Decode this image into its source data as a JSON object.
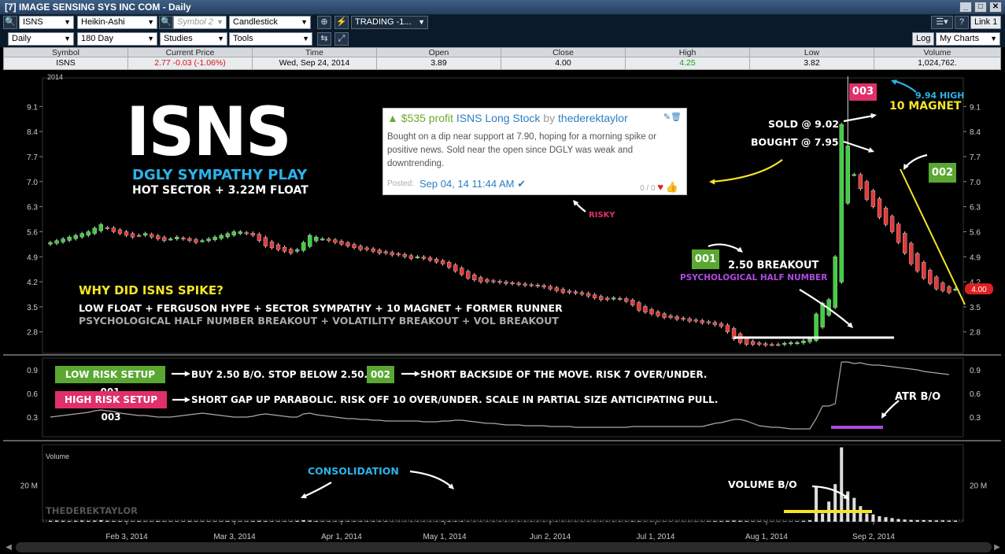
{
  "window": {
    "title": "[7] IMAGE SENSING SYS INC COM - Daily"
  },
  "toolbar1": {
    "symbol": "ISNS",
    "chart_style": "Heikin-Ashi",
    "symbol2_placeholder": "Symbol 2",
    "chart_type": "Candlestick",
    "trading": "TRADING -1...",
    "link": "Link 1"
  },
  "toolbar2": {
    "interval": "Daily",
    "range": "180 Day",
    "studies": "Studies",
    "tools": "Tools",
    "log": "Log",
    "my_charts": "My Charts"
  },
  "quote": {
    "headers": [
      "Symbol",
      "Current Price",
      "Time",
      "Open",
      "Close",
      "High",
      "Low",
      "Volume"
    ],
    "symbol": "ISNS",
    "current_price": "2.77",
    "change": "-0.03 (-1.06%)",
    "time": "Wed, Sep 24, 2014",
    "open": "3.89",
    "close": "4.00",
    "high": "4.25",
    "low": "3.82",
    "volume": "1,024,762."
  },
  "colors": {
    "up": "#3fcf3f",
    "down": "#e23a3a",
    "yellow": "#f4e525",
    "cyan": "#2bb3ea",
    "green_badge": "#5aa832",
    "pink_badge": "#e0306b",
    "purple": "#b04ae0"
  },
  "overlay": {
    "ticker": "ISNS",
    "subtitle1": "DGLY SYMPATHY PLAY",
    "subtitle2": "HOT SECTOR + 3.22M FLOAT",
    "why_title": "WHY DID ISNS SPIKE?",
    "reasons1": "LOW FLOAT + FERGUSON HYPE + SECTOR SYMPATHY + 10 MAGNET + FORMER RUNNER",
    "reasons2": "PSYCHOLOGICAL HALF NUMBER BREAKOUT + VOLATILITY BREAKOUT + VOL BREAKOUT",
    "risky": "RISKY",
    "badge001": "001",
    "badge002": "002",
    "badge003": "003",
    "breakout": "2.50 BREAKOUT",
    "half_number": "PSYCHOLOGICAL HALF NUMBER",
    "sold": "SOLD @ 9.02",
    "bought": "BOUGHT @ 7.95",
    "high_label": "9.94 HIGH",
    "magnet": "10 MAGNET",
    "low_risk": "LOW RISK SETUP 001",
    "low_risk_text": "BUY 2.50 B/O.  STOP BELOW 2.50.",
    "short_text": "SHORT BACKSIDE OF THE MOVE.  RISK 7 OVER/UNDER.",
    "high_risk": "HIGH RISK SETUP 003",
    "high_risk_text": "SHORT GAP UP PARABOLIC.  RISK OFF 10 OVER/UNDER.  SCALE IN PARTIAL SIZE ANTICIPATING PULL.",
    "atr": "ATR B/O",
    "consolidation": "CONSOLIDATION",
    "volume_bo": "VOLUME B/O",
    "watermark": "THEDEREKTAYLOR"
  },
  "post": {
    "profit": "$535 profit",
    "title": "ISNS Long Stock",
    "by": "by",
    "author": "thederektaylor",
    "body": "Bought on a dip near support at 7.90, hoping for a morning spike or positive news. Sold near the open since DGLY was weak and downtrending.",
    "posted": "Posted:",
    "date": "Sep 04, 14 11:44 AM",
    "votes": "0 / 0"
  },
  "chart_data": {
    "type": "candlestick",
    "year_label": "2014",
    "x_labels": [
      "Feb 3, 2014",
      "Mar 3, 2014",
      "Apr 1, 2014",
      "May 1, 2014",
      "Jun 2, 2014",
      "Jul 1, 2014",
      "Aug 1, 2014",
      "Sep 2, 2014"
    ],
    "price_ticks": [
      "9.1",
      "8.4",
      "7.7",
      "7.0",
      "6.3",
      "5.6",
      "4.9",
      "4.2",
      "3.5",
      "2.8"
    ],
    "price_range": [
      2.2,
      9.9
    ],
    "last_price_label": "4.00",
    "atr_ticks": [
      "0.9",
      "0.6",
      "0.3"
    ],
    "atr_range": [
      0.05,
      1.05
    ],
    "volume_label": "Volume",
    "volume_tick": "20 M",
    "volume_range_m": [
      0,
      42
    ],
    "closes": [
      5.3,
      5.35,
      5.4,
      5.45,
      5.5,
      5.55,
      5.6,
      5.7,
      5.8,
      5.7,
      5.6,
      5.55,
      5.5,
      5.45,
      5.5,
      5.55,
      5.45,
      5.4,
      5.35,
      5.4,
      5.45,
      5.4,
      5.35,
      5.3,
      5.35,
      5.4,
      5.45,
      5.5,
      5.55,
      5.6,
      5.6,
      5.55,
      5.5,
      5.35,
      5.2,
      5.15,
      5.1,
      5.05,
      5.0,
      5.1,
      5.3,
      5.5,
      5.45,
      5.4,
      5.35,
      5.3,
      5.25,
      5.2,
      5.15,
      5.1,
      5.1,
      5.05,
      5.0,
      5.0,
      4.95,
      4.95,
      4.9,
      4.85,
      4.9,
      4.85,
      4.8,
      4.75,
      4.7,
      4.6,
      4.5,
      4.4,
      4.3,
      4.25,
      4.2,
      4.2,
      4.2,
      4.18,
      4.15,
      4.15,
      4.12,
      4.1,
      4.1,
      4.08,
      4.05,
      4.0,
      3.95,
      3.9,
      3.9,
      3.88,
      3.85,
      3.8,
      3.75,
      3.7,
      3.7,
      3.75,
      3.72,
      3.65,
      3.55,
      3.4,
      3.35,
      3.3,
      3.25,
      3.2,
      3.2,
      3.15,
      3.15,
      3.1,
      3.1,
      3.05,
      3.05,
      3.0,
      2.95,
      2.8,
      2.6,
      2.5,
      2.45,
      2.45,
      2.45,
      2.43,
      2.45,
      2.45,
      2.48,
      2.5,
      2.5,
      2.55,
      2.6,
      3.3,
      3.6,
      3.7,
      4.9,
      8.6,
      8.0,
      7.2,
      6.8,
      6.5,
      6.3,
      6.0,
      5.8,
      5.6,
      5.3,
      5.0,
      4.7,
      4.5,
      4.3,
      4.15,
      4.0,
      3.95,
      3.9,
      4.0
    ],
    "atr": [
      0.3,
      0.31,
      0.32,
      0.33,
      0.34,
      0.35,
      0.36,
      0.38,
      0.39,
      0.38,
      0.37,
      0.35,
      0.34,
      0.33,
      0.32,
      0.32,
      0.31,
      0.3,
      0.3,
      0.3,
      0.31,
      0.32,
      0.33,
      0.34,
      0.35,
      0.34,
      0.33,
      0.32,
      0.31,
      0.3,
      0.3,
      0.3,
      0.31,
      0.33,
      0.34,
      0.33,
      0.32,
      0.31,
      0.3,
      0.3,
      0.34,
      0.35,
      0.33,
      0.32,
      0.31,
      0.3,
      0.29,
      0.28,
      0.28,
      0.27,
      0.27,
      0.26,
      0.26,
      0.25,
      0.25,
      0.25,
      0.25,
      0.25,
      0.25,
      0.24,
      0.24,
      0.24,
      0.25,
      0.25,
      0.26,
      0.26,
      0.25,
      0.24,
      0.23,
      0.22,
      0.22,
      0.21,
      0.2,
      0.2,
      0.2,
      0.19,
      0.19,
      0.19,
      0.19,
      0.18,
      0.18,
      0.18,
      0.18,
      0.17,
      0.17,
      0.17,
      0.17,
      0.17,
      0.17,
      0.17,
      0.17,
      0.17,
      0.18,
      0.18,
      0.18,
      0.18,
      0.18,
      0.18,
      0.18,
      0.18,
      0.18,
      0.18,
      0.18,
      0.18,
      0.2,
      0.22,
      0.23,
      0.25,
      0.27,
      0.27,
      0.25,
      0.22,
      0.19,
      0.18,
      0.17,
      0.17,
      0.16,
      0.15,
      0.15,
      0.15,
      0.15,
      0.28,
      0.44,
      0.44,
      0.47,
      1.0,
      1.0,
      0.98,
      0.99,
      0.97,
      0.96,
      0.96,
      0.95,
      0.94,
      0.93,
      0.92,
      0.91,
      0.9,
      0.88,
      0.87,
      0.86,
      0.85,
      0.84
    ],
    "volume_m": [
      0.5,
      0.6,
      0.5,
      0.4,
      0.5,
      0.6,
      0.5,
      0.6,
      0.8,
      0.5,
      0.4,
      0.4,
      0.3,
      0.3,
      0.4,
      0.3,
      0.3,
      0.4,
      0.3,
      0.3,
      0.3,
      0.3,
      0.4,
      0.3,
      0.3,
      0.3,
      0.3,
      0.3,
      0.4,
      0.3,
      0.3,
      0.3,
      0.4,
      0.5,
      0.4,
      0.3,
      0.3,
      0.3,
      0.3,
      0.5,
      0.8,
      0.6,
      0.4,
      0.3,
      0.3,
      0.3,
      0.3,
      0.3,
      0.3,
      0.3,
      0.3,
      0.3,
      0.3,
      0.3,
      0.2,
      0.2,
      0.2,
      0.2,
      0.2,
      0.2,
      0.2,
      0.2,
      0.3,
      0.3,
      0.3,
      0.3,
      0.2,
      0.2,
      0.2,
      0.2,
      0.2,
      0.2,
      0.2,
      0.2,
      0.2,
      0.2,
      0.2,
      0.2,
      0.2,
      0.2,
      0.2,
      0.2,
      0.2,
      0.2,
      0.2,
      0.2,
      0.2,
      0.2,
      0.2,
      0.2,
      0.2,
      0.2,
      0.3,
      0.3,
      0.2,
      0.2,
      0.2,
      0.2,
      0.2,
      0.2,
      0.2,
      0.2,
      0.2,
      0.2,
      0.3,
      0.4,
      0.4,
      0.5,
      0.6,
      0.5,
      0.4,
      0.3,
      0.3,
      0.2,
      0.2,
      0.2,
      0.2,
      0.2,
      0.3,
      0.5,
      0.8,
      19.5,
      4.5,
      11.0,
      20.5,
      40.5,
      16.5,
      13.0,
      8.5,
      4.5,
      4.0,
      3.0,
      2.5,
      2.0,
      1.5,
      1.2,
      1.0,
      0.9,
      0.9,
      0.8,
      0.7,
      0.7,
      0.6,
      0.6
    ]
  }
}
